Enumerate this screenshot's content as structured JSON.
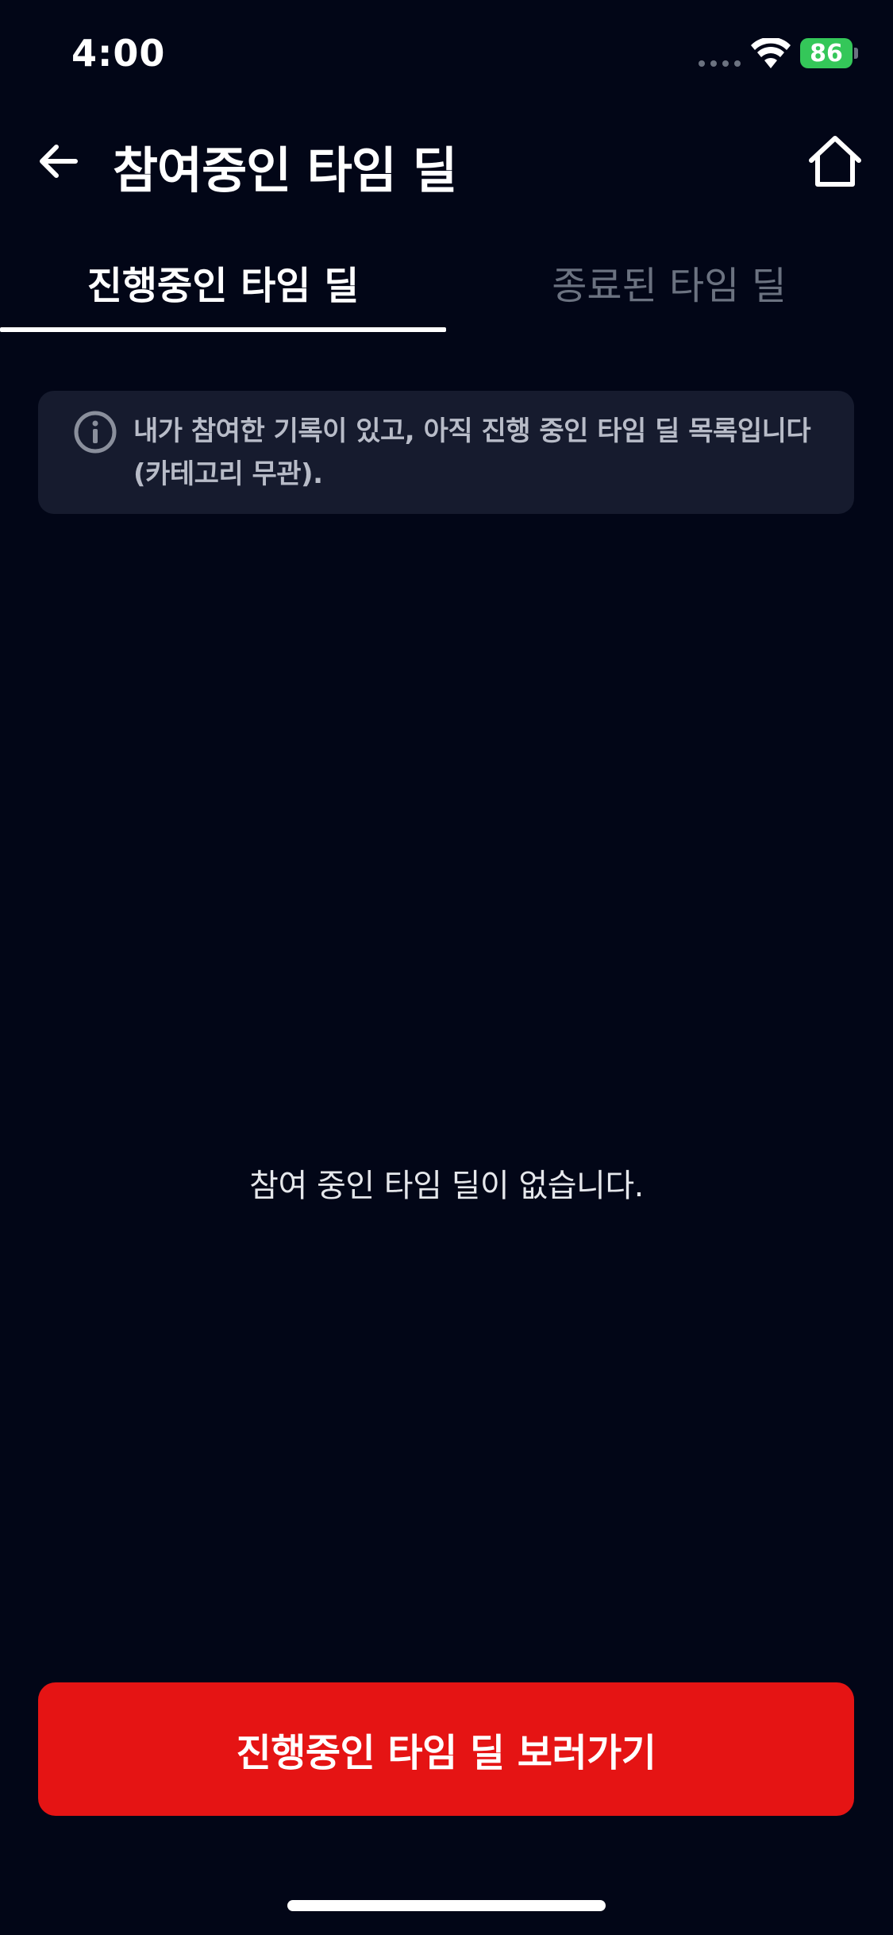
{
  "status_bar": {
    "time": "4:00",
    "battery_level": "86"
  },
  "header": {
    "title": "참여중인 타임 딜",
    "back_icon": "arrow-left-icon",
    "home_icon": "home-icon"
  },
  "tabs": [
    {
      "label": "진행중인 타임 딜",
      "active": true
    },
    {
      "label": "종료된 타임 딜",
      "active": false
    }
  ],
  "info_banner": {
    "icon": "info-icon",
    "text": "내가 참여한 기록이 있고, 아직 진행 중인 타임 딜 목록입니다 (카테고리 무관)."
  },
  "empty_state": {
    "message": "참여 중인 타임 딜이 없습니다."
  },
  "cta": {
    "label": "진행중인 타임 딜 보러가기"
  },
  "colors": {
    "background": "#020617",
    "accent": "#e51414",
    "banner": "#161b2e",
    "inactive_text": "#6b7280",
    "battery": "#34c759"
  }
}
